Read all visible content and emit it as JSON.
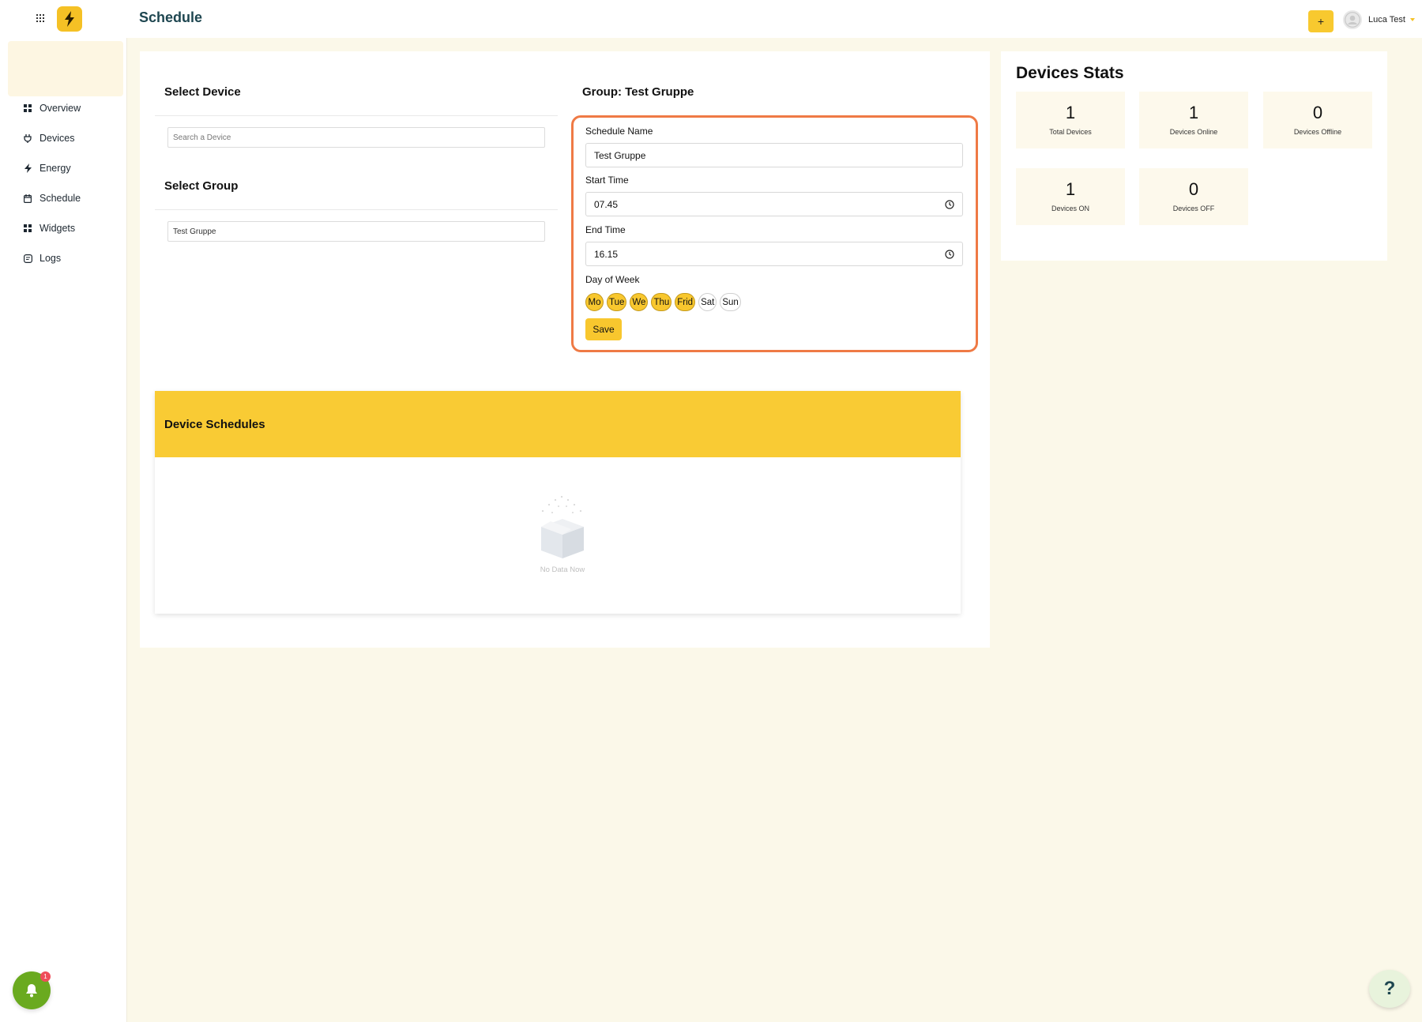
{
  "app": {
    "page_title": "Schedule"
  },
  "sidebar": {
    "items": [
      {
        "label": "Overview",
        "icon": "dashboard-icon"
      },
      {
        "label": "Devices",
        "icon": "plug-icon"
      },
      {
        "label": "Energy",
        "icon": "lightning-icon"
      },
      {
        "label": "Schedule",
        "icon": "calendar-icon"
      },
      {
        "label": "Widgets",
        "icon": "widgets-icon"
      },
      {
        "label": "Logs",
        "icon": "logs-icon"
      }
    ],
    "notification_count": "1"
  },
  "topbar": {
    "add_label": "+",
    "user_name": "Luca Test"
  },
  "select_device": {
    "title": "Select Device",
    "search_placeholder": "Search a Device"
  },
  "select_group": {
    "title": "Select Group",
    "value": "Test Gruppe"
  },
  "schedule_form": {
    "group_title": "Group: Test Gruppe",
    "name_label": "Schedule Name",
    "name_value": "Test Gruppe",
    "start_label": "Start Time",
    "start_value": "07.45",
    "end_label": "End Time",
    "end_value": "16.15",
    "days_label": "Day of Week",
    "days": [
      {
        "label": "Mo",
        "active": true
      },
      {
        "label": "Tue",
        "active": true
      },
      {
        "label": "We",
        "active": true
      },
      {
        "label": "Thu",
        "active": true
      },
      {
        "label": "Frid",
        "active": true
      },
      {
        "label": "Sat",
        "active": false
      },
      {
        "label": "Sun",
        "active": false
      }
    ],
    "save_label": "Save"
  },
  "device_schedules": {
    "title": "Device Schedules",
    "empty_text": "No Data Now"
  },
  "stats": {
    "title": "Devices Stats",
    "items": [
      {
        "value": "1",
        "label": "Total Devices"
      },
      {
        "value": "1",
        "label": "Devices Online"
      },
      {
        "value": "0",
        "label": "Devices Offline"
      },
      {
        "value": "1",
        "label": "Devices ON"
      },
      {
        "value": "0",
        "label": "Devices OFF"
      }
    ]
  },
  "help_label": "?",
  "colors": {
    "accent": "#f8c72e",
    "highlight_border": "#ef7a45",
    "title": "#1e4650",
    "background": "#fbf8e9"
  }
}
